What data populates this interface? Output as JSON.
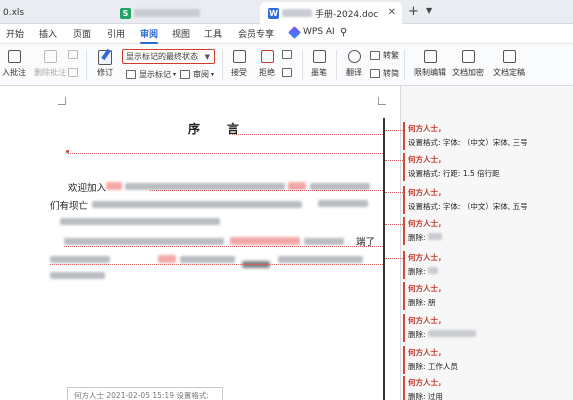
{
  "tabs": [
    {
      "label": "0.xls"
    },
    {
      "label": "S"
    },
    {
      "label": "手册-2024.doc",
      "icon": "W"
    }
  ],
  "menu": [
    "开始",
    "插入",
    "页面",
    "引用",
    "审阅",
    "视图",
    "工具",
    "会员专享",
    "WPS AI"
  ],
  "active_menu": "审阅",
  "toolbar": {
    "insert_comment": "入批注",
    "delete_comment": "删除批注",
    "revise": "修订",
    "markup_select": "显示标记的最终状态",
    "show_markup": "显示标记",
    "review": "审阅",
    "accept": "接受",
    "reject": "拒绝",
    "ink": "墨笔",
    "translate": "翻译",
    "simplified": "转繁",
    "traditional": "转简",
    "restrict": "限制编辑",
    "encrypt": "文档加密",
    "finalize": "文档定稿"
  },
  "document": {
    "title_left": "序",
    "title_right": "言",
    "line1_start": "欢迎加入",
    "line2_start": "们有坝亡",
    "line3_end": "端了"
  },
  "comments": [
    {
      "author": "何方人士，",
      "text": "设置格式: 字体: （中文）宋体, 三号"
    },
    {
      "author": "何方人士，",
      "text": "设置格式: 行距: 1.5 倍行距"
    },
    {
      "author": "何方人士，",
      "text": "设置格式: 字体: （中文）宋体, 五号"
    },
    {
      "author": "何方人士，",
      "text": "删除:"
    },
    {
      "author": "何方人士，",
      "text": "删除:"
    },
    {
      "author": "何方人士，",
      "text": "删除: 朋"
    },
    {
      "author": "何方人士，",
      "text": "删除:"
    },
    {
      "author": "何方人士，",
      "text": "删除: 工作人员"
    },
    {
      "author": "何方人士，",
      "text": "删除: 过用"
    }
  ],
  "bottom_bubble": "何方人士    2021-02-05 15:19 设置格式:"
}
